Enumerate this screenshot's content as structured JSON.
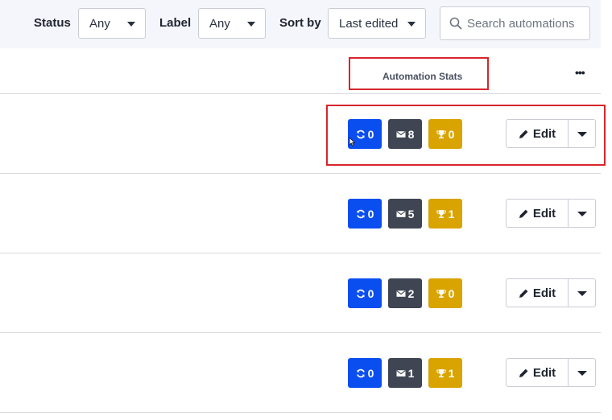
{
  "filters": {
    "status": {
      "label": "Status",
      "value": "Any"
    },
    "label": {
      "label": "Label",
      "value": "Any"
    },
    "sort": {
      "label": "Sort by",
      "value": "Last edited"
    },
    "search": {
      "placeholder": "Search automations",
      "value": ""
    }
  },
  "table": {
    "stats_header": "Automation Stats",
    "more_label": "•••"
  },
  "colors": {
    "active_badge": "#0a4ef0",
    "email_badge": "#3f4552",
    "goal_badge": "#d9a300",
    "highlight": "#d7262c"
  },
  "rows": [
    {
      "active": "0",
      "emails": "8",
      "goals": "0",
      "edit_label": "Edit"
    },
    {
      "active": "0",
      "emails": "5",
      "goals": "1",
      "edit_label": "Edit"
    },
    {
      "active": "0",
      "emails": "2",
      "goals": "0",
      "edit_label": "Edit"
    },
    {
      "active": "0",
      "emails": "1",
      "goals": "1",
      "edit_label": "Edit"
    }
  ]
}
